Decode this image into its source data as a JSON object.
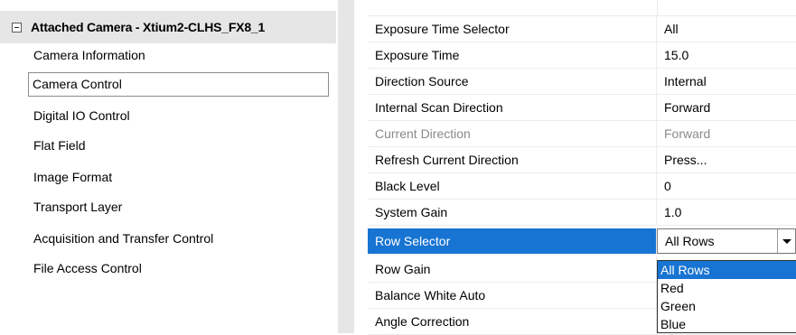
{
  "tree": {
    "root_title": "Attached Camera - Xtium2-CLHS_FX8_1",
    "items": [
      {
        "label": "Camera Information"
      },
      {
        "label": "Camera Control"
      },
      {
        "label": "Digital IO Control"
      },
      {
        "label": "Flat Field"
      },
      {
        "label": "Image Format"
      },
      {
        "label": "Transport Layer"
      },
      {
        "label": "Acquisition and Transfer Control"
      },
      {
        "label": "File Access Control"
      }
    ],
    "selected_item": "Camera Control"
  },
  "grid": {
    "rows": [
      {
        "name": "Exposure Time Selector",
        "value": "All"
      },
      {
        "name": "Exposure Time",
        "value": "15.0"
      },
      {
        "name": "Direction Source",
        "value": "Internal"
      },
      {
        "name": "Internal Scan Direction",
        "value": "Forward"
      },
      {
        "name": "Current Direction",
        "value": "Forward"
      },
      {
        "name": "Refresh Current Direction",
        "value": "Press..."
      },
      {
        "name": "Black Level",
        "value": "0"
      },
      {
        "name": "System Gain",
        "value": "1.0"
      },
      {
        "name": "Row Selector",
        "value": "All Rows"
      },
      {
        "name": "Row Gain",
        "value": ""
      },
      {
        "name": "Balance White Auto",
        "value": ""
      },
      {
        "name": "Angle Correction",
        "value": ""
      }
    ]
  },
  "dropdown": {
    "options": [
      "All Rows",
      "Red",
      "Green",
      "Blue"
    ],
    "highlighted": "All Rows"
  },
  "colors": {
    "selection": "#1874d2",
    "header_bg": "#e6e6e6",
    "disabled_text": "#8a8a8a"
  }
}
